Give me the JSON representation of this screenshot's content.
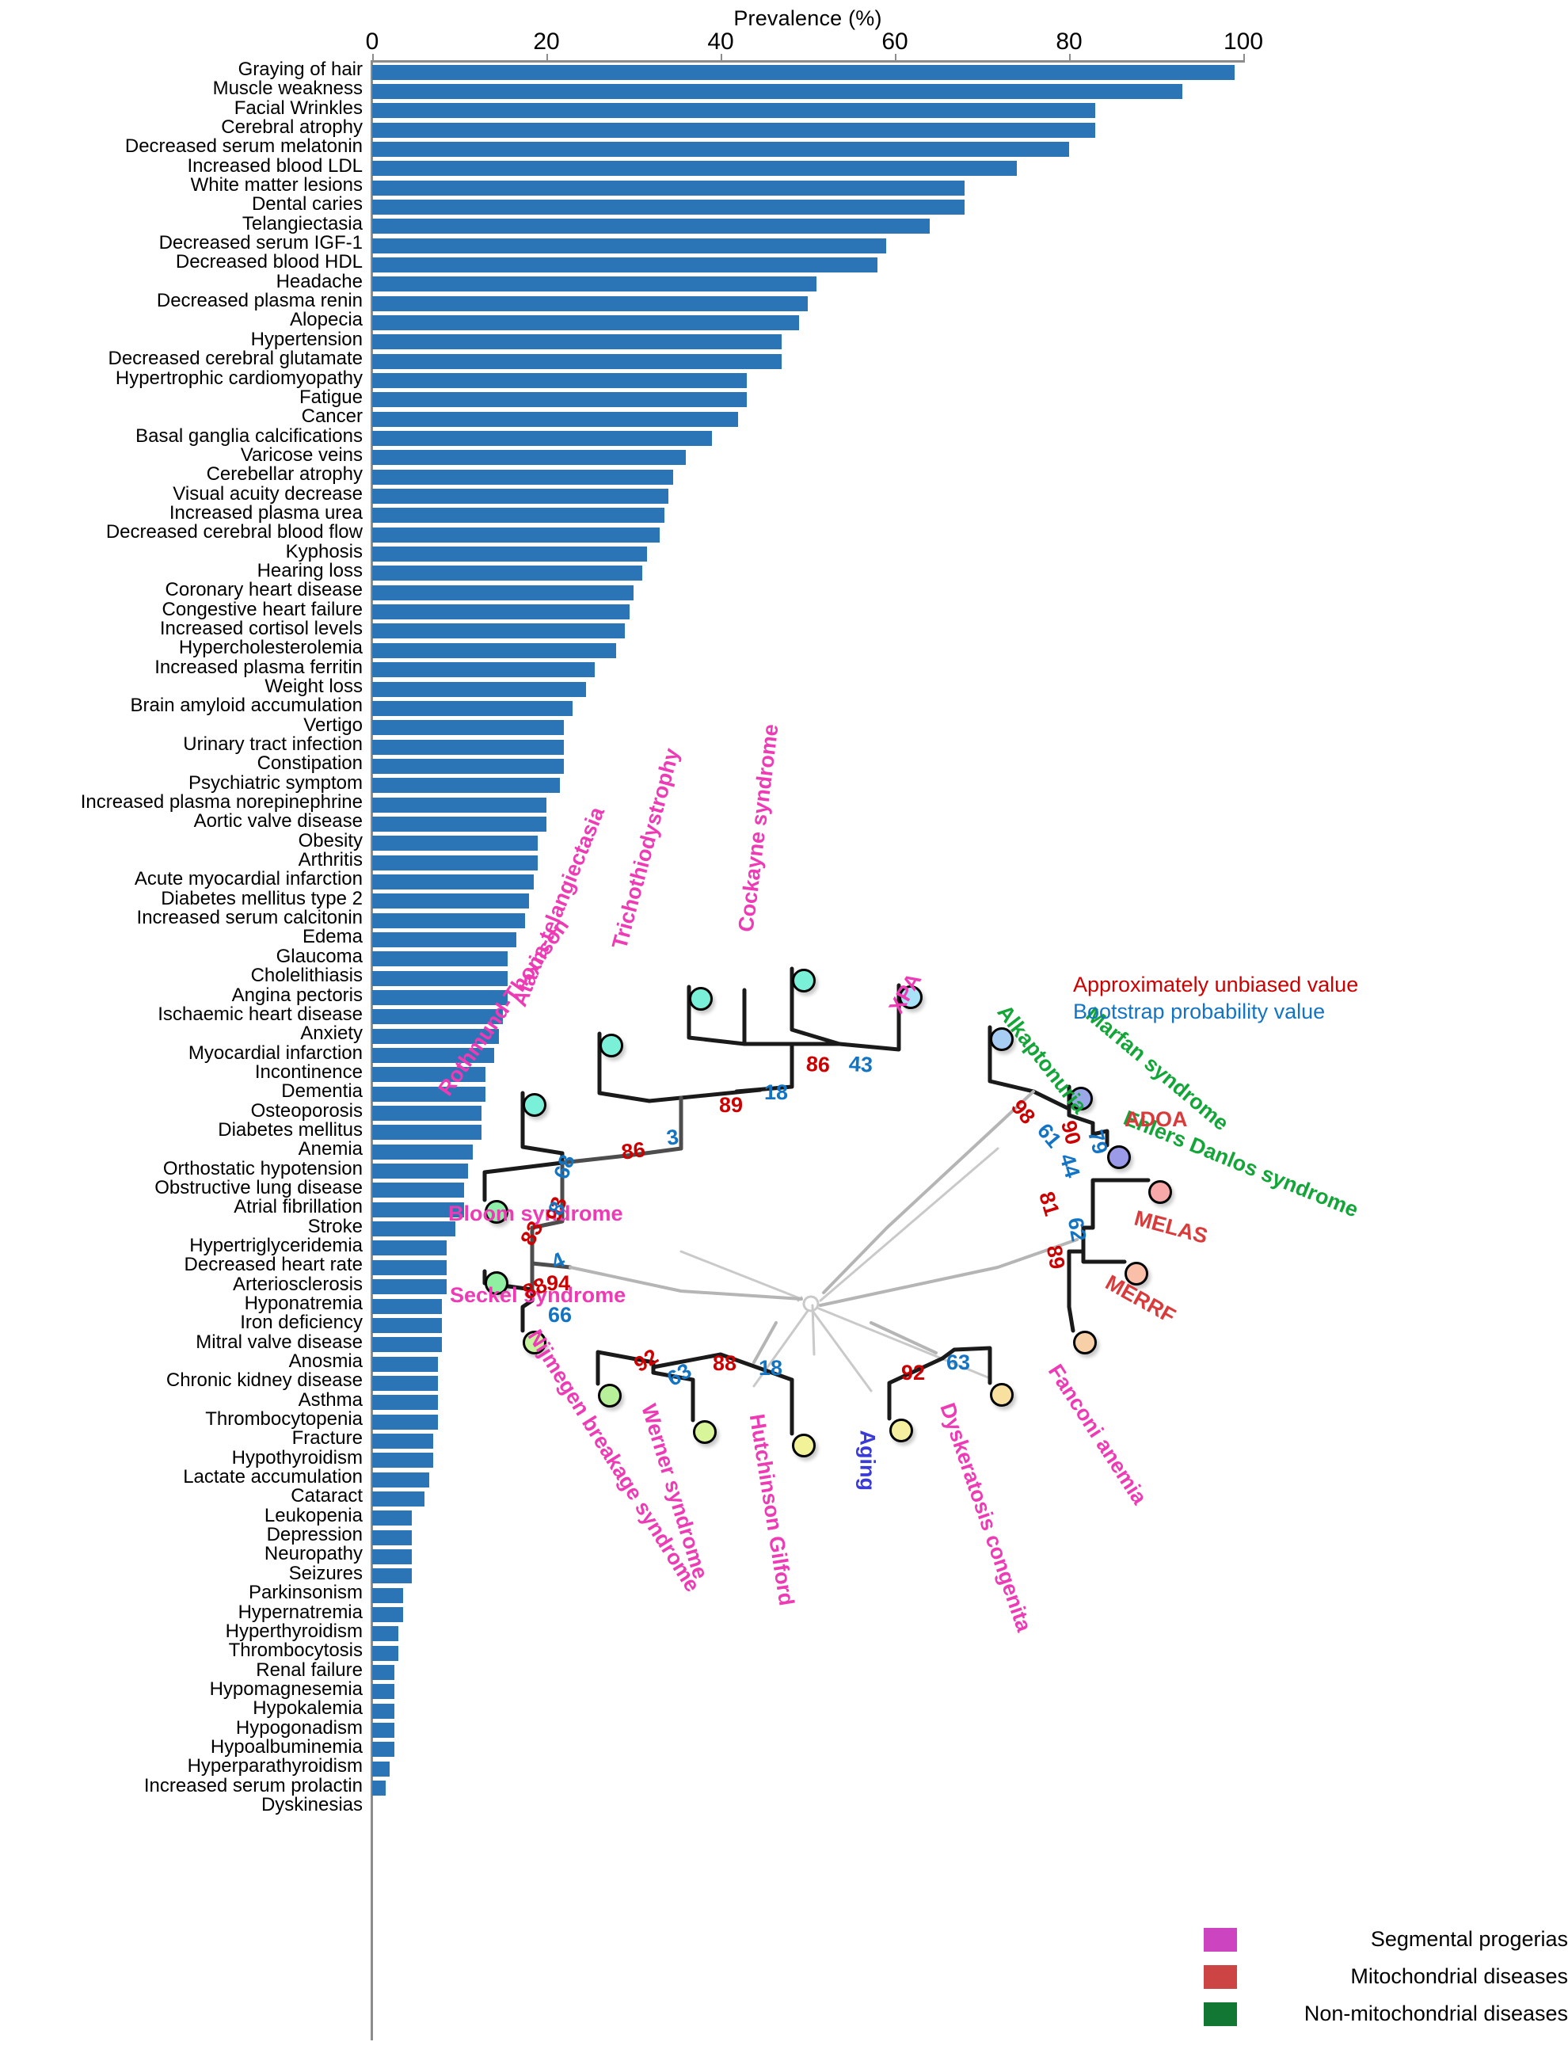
{
  "chart_data": [
    {
      "type": "bar",
      "title": "Prevalence (%)",
      "xlabel": "Prevalence (%)",
      "ylabel": "",
      "orientation": "horizontal",
      "xlim": [
        0,
        100
      ],
      "xticks": [
        0,
        20,
        40,
        60,
        80,
        100
      ],
      "grid": false,
      "bar_color": "#2b75b6",
      "categories": [
        "Graying of hair",
        "Muscle weakness",
        "Facial Wrinkles",
        "Cerebral atrophy",
        "Decreased serum melatonin",
        "Increased blood LDL",
        "White matter lesions",
        "Dental caries",
        "Telangiectasia",
        "Decreased serum IGF-1",
        "Decreased blood HDL",
        "Headache",
        "Decreased plasma renin",
        "Alopecia",
        "Hypertension",
        "Decreased cerebral glutamate",
        "Hypertrophic cardiomyopathy",
        "Fatigue",
        "Cancer",
        "Basal ganglia calcifications",
        "Varicose veins",
        "Cerebellar atrophy",
        "Visual acuity decrease",
        "Increased plasma urea",
        "Decreased cerebral blood flow",
        "Kyphosis",
        "Hearing loss",
        "Coronary heart disease",
        "Congestive heart failure",
        "Increased cortisol levels",
        "Hypercholesterolemia",
        "Increased plasma ferritin",
        "Weight loss",
        "Brain amyloid accumulation",
        "Vertigo",
        "Urinary tract infection",
        "Constipation",
        "Psychiatric symptom",
        "Increased plasma norepinephrine",
        "Aortic valve disease",
        "Obesity",
        "Arthritis",
        "Acute myocardial infarction",
        "Diabetes mellitus type 2",
        "Increased serum calcitonin",
        "Edema",
        "Glaucoma",
        "Cholelithiasis",
        "Angina pectoris",
        "Ischaemic heart disease",
        "Anxiety",
        "Myocardial infarction",
        "Incontinence",
        "Dementia",
        "Osteoporosis",
        "Diabetes mellitus",
        "Anemia",
        "Orthostatic hypotension",
        "Obstructive lung disease",
        "Atrial fibrillation",
        "Stroke",
        "Hypertriglyceridemia",
        "Decreased heart rate",
        "Arteriosclerosis",
        "Hyponatremia",
        "Iron deficiency",
        "Mitral valve disease",
        "Anosmia",
        "Chronic kidney disease",
        "Asthma",
        "Thrombocytopenia",
        "Fracture",
        "Hypothyroidism",
        "Lactate accumulation",
        "Cataract",
        "Leukopenia",
        "Depression",
        "Neuropathy",
        "Seizures",
        "Parkinsonism",
        "Hypernatremia",
        "Hyperthyroidism",
        "Thrombocytosis",
        "Renal failure",
        "Hypomagnesemia",
        "Hypokalemia",
        "Hypogonadism",
        "Hypoalbuminemia",
        "Hyperparathyroidism",
        "Increased serum prolactin",
        "Dyskinesias"
      ],
      "values": [
        99,
        93,
        83,
        83,
        80,
        74,
        68,
        68,
        64,
        59,
        58,
        51,
        50,
        49,
        47,
        47,
        43,
        43,
        42,
        39,
        36,
        34.5,
        34,
        33.5,
        33,
        31.5,
        31,
        30,
        29.5,
        29,
        28,
        25.5,
        24.5,
        23,
        22,
        22,
        22,
        21.5,
        20,
        20,
        19,
        19,
        18.5,
        18,
        17.5,
        16.5,
        15.5,
        15.5,
        15.5,
        15,
        14.5,
        14,
        13,
        13,
        12.5,
        12.5,
        11.5,
        11,
        10.5,
        10.5,
        9.5,
        8.5,
        8.5,
        8.5,
        8,
        8,
        8,
        7.5,
        7.5,
        7.5,
        7.5,
        7,
        7,
        6.5,
        6,
        4.5,
        4.5,
        4.5,
        4.5,
        3.5,
        3.5,
        3,
        3,
        2.5,
        2.5,
        2.5,
        2.5,
        2.5,
        2,
        1.5
      ]
    },
    {
      "type": "tree",
      "description": "Circular hierarchical clustering dendrogram of segmental progerias, mitochondrial diseases, non-mitochondrial diseases and normal Aging, with AU (approximately unbiased) and BP (bootstrap probability) support values.",
      "value_key": {
        "au_label": "Approximately unbiased value",
        "au_color": "#cc0000",
        "bp_label": "Bootstrap probability value",
        "bp_color": "#1374c4"
      },
      "leaves": [
        {
          "name": "Rothmund-Thomson",
          "group": "Segmental progerias",
          "color": "#7af0d9"
        },
        {
          "name": "Ataxia-telangiectasia",
          "group": "Segmental progerias",
          "color": "#7af0d9"
        },
        {
          "name": "Trichothiodystrophy",
          "group": "Segmental progerias",
          "color": "#7af0d9"
        },
        {
          "name": "Cockayne syndrome",
          "group": "Segmental progerias",
          "color": "#7af0d9"
        },
        {
          "name": "XPA",
          "group": "Segmental progerias",
          "color": "#a8e3f7"
        },
        {
          "name": "Alkaptonuria",
          "group": "Non-mitochondrial diseases",
          "color": "#a8cdf2"
        },
        {
          "name": "Marfan syndrome",
          "group": "Non-mitochondrial diseases",
          "color": "#9aa8e8"
        },
        {
          "name": "Ehlers Danlos syndrome",
          "group": "Non-mitochondrial diseases",
          "color": "#9a9ae8"
        },
        {
          "name": "Bloom syndrome",
          "group": "Segmental progerias",
          "color": "#8ef0a8"
        },
        {
          "name": "Seckel syndrome",
          "group": "Segmental progerias",
          "color": "#8ef0a0"
        },
        {
          "name": "Nijmegen breakage syndrome",
          "group": "Segmental progerias",
          "color": "#c6f5a0"
        },
        {
          "name": "Werner syndrome",
          "group": "Segmental progerias",
          "color": "#b8f09a"
        },
        {
          "name": "Hutchinson Gilford",
          "group": "Segmental progerias",
          "color": "#d8f59a"
        },
        {
          "name": "Aging",
          "group": "Aging",
          "color": "#f2f299"
        },
        {
          "name": "Dyskeratosis congenita",
          "group": "Segmental progerias",
          "color": "#f5efa0"
        },
        {
          "name": "Fanconi anemia",
          "group": "Segmental progerias",
          "color": "#f7e0a0"
        },
        {
          "name": "MERRF",
          "group": "Mitochondrial diseases",
          "color": "#fad3a8"
        },
        {
          "name": "MELAS",
          "group": "Mitochondrial diseases",
          "color": "#fabfa8"
        },
        {
          "name": "ADOA",
          "group": "Mitochondrial diseases",
          "color": "#f7a8a8"
        }
      ],
      "support_values": [
        {
          "id": "n_tri_cock",
          "au": 86,
          "bp": 43
        },
        {
          "id": "n_tri_cock_xpa",
          "au": 89,
          "bp": 18
        },
        {
          "id": "n_ataxia_clade",
          "au": 86,
          "bp": 3
        },
        {
          "id": "n_rothmund_bloom",
          "au": 93,
          "bp": 68
        },
        {
          "id": "n_progeria_upper",
          "au": 83,
          "bp": 8
        },
        {
          "id": "n_seckel_nijmegen",
          "au": 94,
          "bp": 66
        },
        {
          "id": "n_progeria_all",
          "au": 88,
          "bp": 4
        },
        {
          "id": "n_werner_hg",
          "au": 92,
          "bp": 63
        },
        {
          "id": "n_werner_hg_aging",
          "au": 88,
          "bp": 18
        },
        {
          "id": "n_dysk_fanconi",
          "au": 92,
          "bp": 63
        },
        {
          "id": "n_melas_merrf",
          "au": 89,
          "bp": 62
        },
        {
          "id": "n_mito_all",
          "au": 81,
          "bp": 44
        },
        {
          "id": "n_marfan_ehlers",
          "au": 90,
          "bp": 79
        },
        {
          "id": "n_nonmito_all",
          "au": 98,
          "bp": 61
        }
      ]
    }
  ],
  "axis": {
    "title": "Prevalence (%)",
    "ticks": [
      "0",
      "20",
      "40",
      "60",
      "80",
      "100"
    ]
  },
  "value_key": {
    "au": "Approximately unbiased value",
    "bp": "Bootstrap probability value"
  },
  "legend": {
    "items": [
      {
        "label": "Segmental progerias",
        "color": "#cc44c0",
        "swatch": true
      },
      {
        "label": "Mitochondrial diseases",
        "color": "#cc4444",
        "swatch": true
      },
      {
        "label": "Non-mitochondrial diseases",
        "color": "#117733",
        "swatch": true
      }
    ]
  },
  "tree_labels": [
    {
      "text": "Rothmund-Thomson",
      "color": "pink",
      "left": 0,
      "top": 215,
      "rot": -55
    },
    {
      "text": "Ataxia-telangiectasia",
      "color": "pink",
      "left": 95,
      "top": 104,
      "rot": -68
    },
    {
      "text": "Trichothiodystrophy",
      "color": "pink",
      "left": 222,
      "top": 32,
      "rot": -75
    },
    {
      "text": "Cockayne syndrome",
      "color": "pink",
      "left": 382,
      "top": 11,
      "rot": -83
    },
    {
      "text": "XPA",
      "color": "pink",
      "left": 570,
      "top": 112,
      "rot": -60
    },
    {
      "text": "Alkaptonuria",
      "color": "green",
      "left": 705,
      "top": 107,
      "rot": 52
    },
    {
      "text": "Marfan syndrome",
      "color": "green",
      "left": 815,
      "top": 112,
      "rot": 40
    },
    {
      "text": "Ehlers Danlos syndrome",
      "color": "green",
      "left": 860,
      "top": 245,
      "rot": 22
    },
    {
      "text": "Bloom syndrome",
      "color": "pink",
      "left": 6,
      "top": 367,
      "rot": 0
    },
    {
      "text": "Seckel syndrome",
      "color": "pink",
      "left": 8,
      "top": 470,
      "rot": 0
    },
    {
      "text": "Nijmegen breakage syndrome",
      "color": "pink",
      "left": 113,
      "top": 516,
      "rot": 58
    },
    {
      "text": "Werner syndrome",
      "color": "pink",
      "left": 258,
      "top": 608,
      "rot": 73
    },
    {
      "text": "Hutchinson Gilford",
      "color": "pink",
      "left": 395,
      "top": 620,
      "rot": 81
    },
    {
      "text": "Aging",
      "color": "blue",
      "left": 535,
      "top": 640,
      "rot": 90
    },
    {
      "text": "Dyskeratosis congenita",
      "color": "pink",
      "left": 635,
      "top": 607,
      "rot": 71
    },
    {
      "text": "Fanconi anemia",
      "color": "pink",
      "left": 770,
      "top": 560,
      "rot": 57
    },
    {
      "text": "MERRF",
      "color": "red",
      "left": 838,
      "top": 452,
      "rot": 29
    },
    {
      "text": "MELAS",
      "color": "red",
      "left": 873,
      "top": 372,
      "rot": 15
    },
    {
      "text": "ADOA",
      "color": "red",
      "left": 860,
      "top": 248,
      "rot": 0
    }
  ],
  "tree_nodes": [
    {
      "name": "rothmund-thomson",
      "left": 100,
      "top": 230,
      "color": "#7af0d9"
    },
    {
      "name": "ataxia-telangiectasia",
      "left": 197,
      "top": 155,
      "color": "#7af0d9"
    },
    {
      "name": "trichothiodystrophy",
      "left": 310,
      "top": 96,
      "color": "#7af0d9"
    },
    {
      "name": "cockayne-syndrome",
      "left": 440,
      "top": 73,
      "color": "#7af0d9"
    },
    {
      "name": "xpa",
      "left": 575,
      "top": 94,
      "color": "#a8e3f7"
    },
    {
      "name": "alkaptonuria",
      "left": 690,
      "top": 147,
      "color": "#a8cdf2"
    },
    {
      "name": "marfan-syndrome",
      "left": 790,
      "top": 222,
      "color": "#9aa8e8"
    },
    {
      "name": "ehlers-danlos",
      "left": 838,
      "top": 296,
      "color": "#9a9ae8"
    },
    {
      "name": "bloom-syndrome",
      "left": 52,
      "top": 365,
      "color": "#8ef0a8"
    },
    {
      "name": "seckel-syndrome",
      "left": 52,
      "top": 455,
      "color": "#8ef0a0"
    },
    {
      "name": "nijmegen-breakage",
      "left": 100,
      "top": 530,
      "color": "#c6f5a0"
    },
    {
      "name": "werner-syndrome",
      "left": 195,
      "top": 597,
      "color": "#b8f09a"
    },
    {
      "name": "hutchinson-gilford",
      "left": 315,
      "top": 643,
      "color": "#d8f59a"
    },
    {
      "name": "aging",
      "left": 440,
      "top": 660,
      "color": "#f2f299"
    },
    {
      "name": "dyskeratosis",
      "left": 563,
      "top": 641,
      "color": "#f5efa0"
    },
    {
      "name": "fanconi-anemia",
      "left": 690,
      "top": 596,
      "color": "#f7e0a0"
    },
    {
      "name": "merrf",
      "left": 795,
      "top": 530,
      "color": "#f7d0a8"
    },
    {
      "name": "melas",
      "left": 860,
      "top": 443,
      "color": "#fabfa8"
    },
    {
      "name": "adoa",
      "left": 890,
      "top": 340,
      "color": "#f7a8a8"
    }
  ],
  "tree_supports": [
    {
      "au": "86",
      "bp": "43",
      "au_left": 458,
      "au_top": 178,
      "bp_left": 512,
      "bp_top": 178,
      "rot": 3
    },
    {
      "au": "89",
      "bp": "18",
      "au_left": 348,
      "au_top": 230,
      "bp_left": 405,
      "bp_top": 214,
      "rot": 0
    },
    {
      "au": "86",
      "bp": "3",
      "au_left": 225,
      "au_top": 290,
      "bp_left": 282,
      "bp_top": 272,
      "rot": -8
    },
    {
      "au": "93",
      "bp": "68",
      "au_left": 138,
      "au_top": 375,
      "bp_left": 148,
      "bp_top": 322,
      "rot": -70
    },
    {
      "au": "83",
      "bp": "8",
      "au_left": 105,
      "au_top": 405,
      "bp_left": 140,
      "bp_top": 367,
      "rot": -62
    },
    {
      "au": "94",
      "bp": "66",
      "au_left": 130,
      "au_top": 455,
      "bp_left": 132,
      "bp_top": 495,
      "rot": 0
    },
    {
      "au": "88",
      "bp": "4",
      "au_left": 102,
      "au_top": 468,
      "bp_left": 138,
      "bp_top": 430,
      "rot": -25
    },
    {
      "au": "92",
      "bp": "63",
      "au_left": 243,
      "au_top": 560,
      "bp_left": 285,
      "bp_top": 578,
      "rot": -30
    },
    {
      "au": "88",
      "bp": "18",
      "au_left": 340,
      "au_top": 556,
      "bp_left": 398,
      "bp_top": 562,
      "rot": 0
    },
    {
      "au": "92",
      "bp": "63",
      "au_left": 578,
      "au_top": 568,
      "bp_left": 635,
      "bp_top": 555,
      "rot": 0
    },
    {
      "au": "89",
      "bp": "62",
      "au_left": 770,
      "au_top": 407,
      "bp_left": 797,
      "bp_top": 372,
      "rot": 80
    },
    {
      "au": "81",
      "bp": "44",
      "au_left": 760,
      "au_top": 340,
      "bp_left": 786,
      "bp_top": 292,
      "rot": 73
    },
    {
      "au": "90",
      "bp": "79",
      "au_left": 788,
      "au_top": 250,
      "bp_left": 822,
      "bp_top": 262,
      "rot": 75
    },
    {
      "au": "98",
      "bp": "61",
      "au_left": 722,
      "au_top": 227,
      "bp_left": 755,
      "bp_top": 257,
      "rot": 50
    }
  ]
}
